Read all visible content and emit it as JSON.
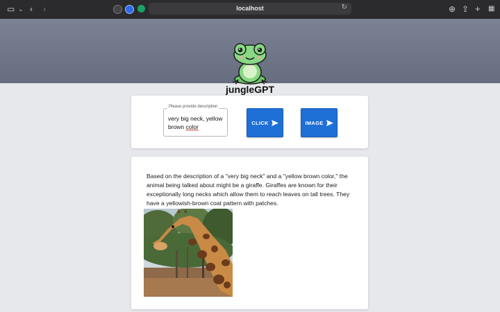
{
  "browser": {
    "url": "localhost"
  },
  "header": {
    "brand": "jungleGPT"
  },
  "query": {
    "label": "Please provide description",
    "value_line1": "very big neck, yellow",
    "value_line2_a": "brown ",
    "value_line2_b": "color"
  },
  "buttons": {
    "click_label": "CLICK",
    "image_label": "IMAGE"
  },
  "result": {
    "text": "Based on the description of a \"very big neck\" and a \"yellow brown color,\" the animal being talked about might be a giraffe. Giraffes are known for their exceptionally long necks which allow them to reach leaves on tall trees. They have a yellowish-brown coat pattern with patches."
  },
  "colors": {
    "header_bg": "#6b7384",
    "button_bg": "#1e6fd6",
    "page_bg": "#e7e8ec"
  }
}
